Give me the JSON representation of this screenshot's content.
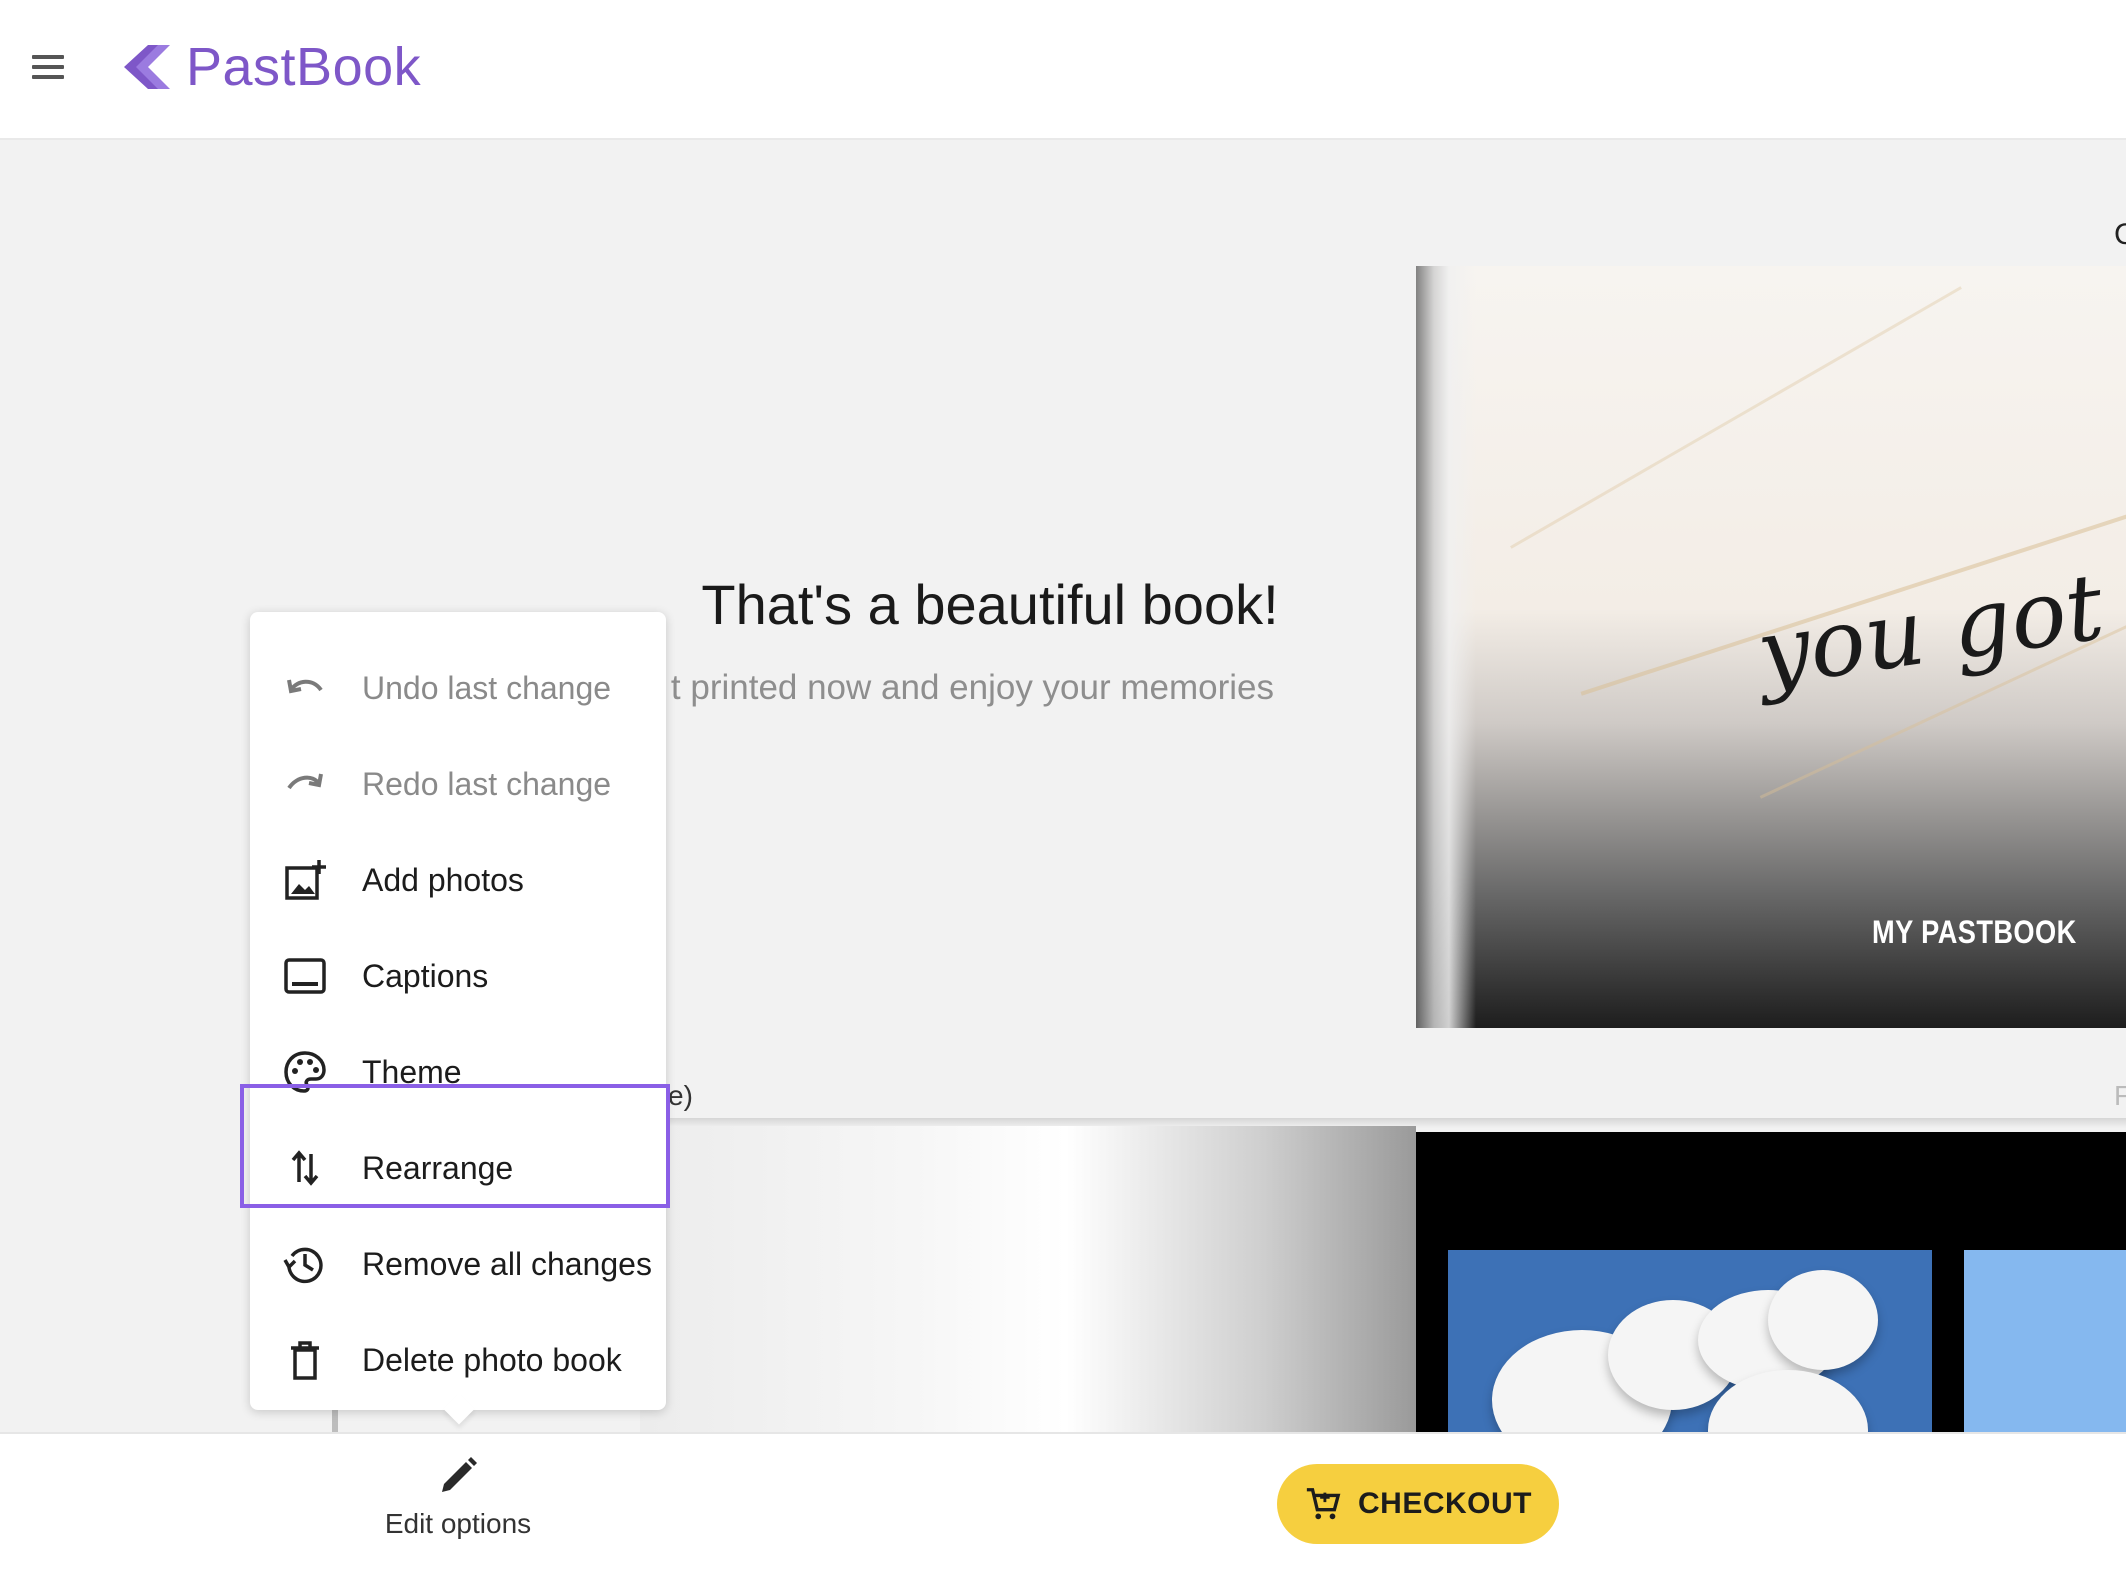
{
  "header": {
    "brand_name": "PastBook",
    "brand_color": "#7e57c8",
    "menu_icon": "hamburger-icon"
  },
  "hero": {
    "title": "That's a beautiful book!",
    "subtitle": "t printed now and enjoy your memories"
  },
  "book": {
    "cover_script": "you got thi",
    "cover_brand": "MY PASTBOOK",
    "partial_label_left": "e)",
    "partial_label_right": "F",
    "corner_char": "C"
  },
  "edit_menu": {
    "items": [
      {
        "label": "Undo last change",
        "icon": "undo-icon",
        "enabled": false
      },
      {
        "label": "Redo last change",
        "icon": "redo-icon",
        "enabled": false
      },
      {
        "label": "Add photos",
        "icon": "add-photo-icon",
        "enabled": true
      },
      {
        "label": "Captions",
        "icon": "captions-icon",
        "enabled": true
      },
      {
        "label": "Theme",
        "icon": "palette-icon",
        "enabled": true
      },
      {
        "label": "Rearrange",
        "icon": "swap-vertical-icon",
        "enabled": true,
        "highlighted": true
      },
      {
        "label": "Remove all changes",
        "icon": "history-icon",
        "enabled": true
      },
      {
        "label": "Delete photo book",
        "icon": "trash-icon",
        "enabled": true
      }
    ],
    "highlight_color": "#8a5fe6"
  },
  "bottom_bar": {
    "edit_options_label": "Edit options",
    "checkout_label": "CHECKOUT",
    "checkout_color": "#f6cf3f"
  }
}
